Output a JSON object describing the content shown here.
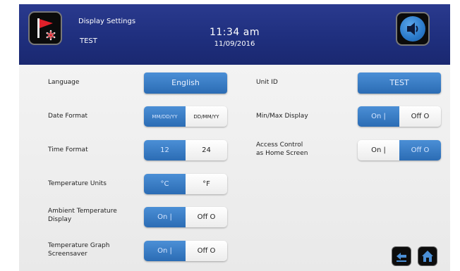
{
  "header": {
    "title": "Display Settings",
    "subtitle": "TEST",
    "time": "11:34 am",
    "date": "11/09/2016"
  },
  "settings": {
    "language": {
      "label": "Language",
      "value": "English"
    },
    "date_format": {
      "label": "Date Format",
      "options": [
        "MM/DD/YY",
        "DD/MM/YY"
      ],
      "selected": "MM/DD/YY"
    },
    "time_format": {
      "label": "Time Format",
      "options": [
        "12",
        "24"
      ],
      "selected": "12"
    },
    "temperature_units": {
      "label": "Temperature Units",
      "options": [
        "°C",
        "°F"
      ],
      "selected": "°C"
    },
    "ambient_temperature_display": {
      "label_line1": "Ambient Temperature",
      "label_line2": "Display",
      "options": [
        "On |",
        "Off O"
      ],
      "selected": "On |"
    },
    "temperature_graph_screensaver": {
      "label_line1": "Temperature Graph",
      "label_line2": "Screensaver",
      "options": [
        "On |",
        "Off O"
      ],
      "selected": "On |"
    },
    "unit_id": {
      "label": "Unit ID",
      "value": "TEST"
    },
    "min_max_display": {
      "label": "Min/Max Display",
      "options": [
        "On |",
        "Off O"
      ],
      "selected": "On |"
    },
    "access_control_home": {
      "label_line1": "Access Control",
      "label_line2": "as Home Screen",
      "options": [
        "On |",
        "Off O"
      ],
      "selected": "Off O"
    }
  },
  "icons": {
    "alarm": "red-flag-asterisk-icon",
    "sound": "speaker-icon",
    "back": "back-arrow-icon",
    "home": "home-icon"
  },
  "colors": {
    "header_blue": "#1f2f7e",
    "button_blue": "#2b6cb4",
    "alarm_red": "#e0202a"
  }
}
